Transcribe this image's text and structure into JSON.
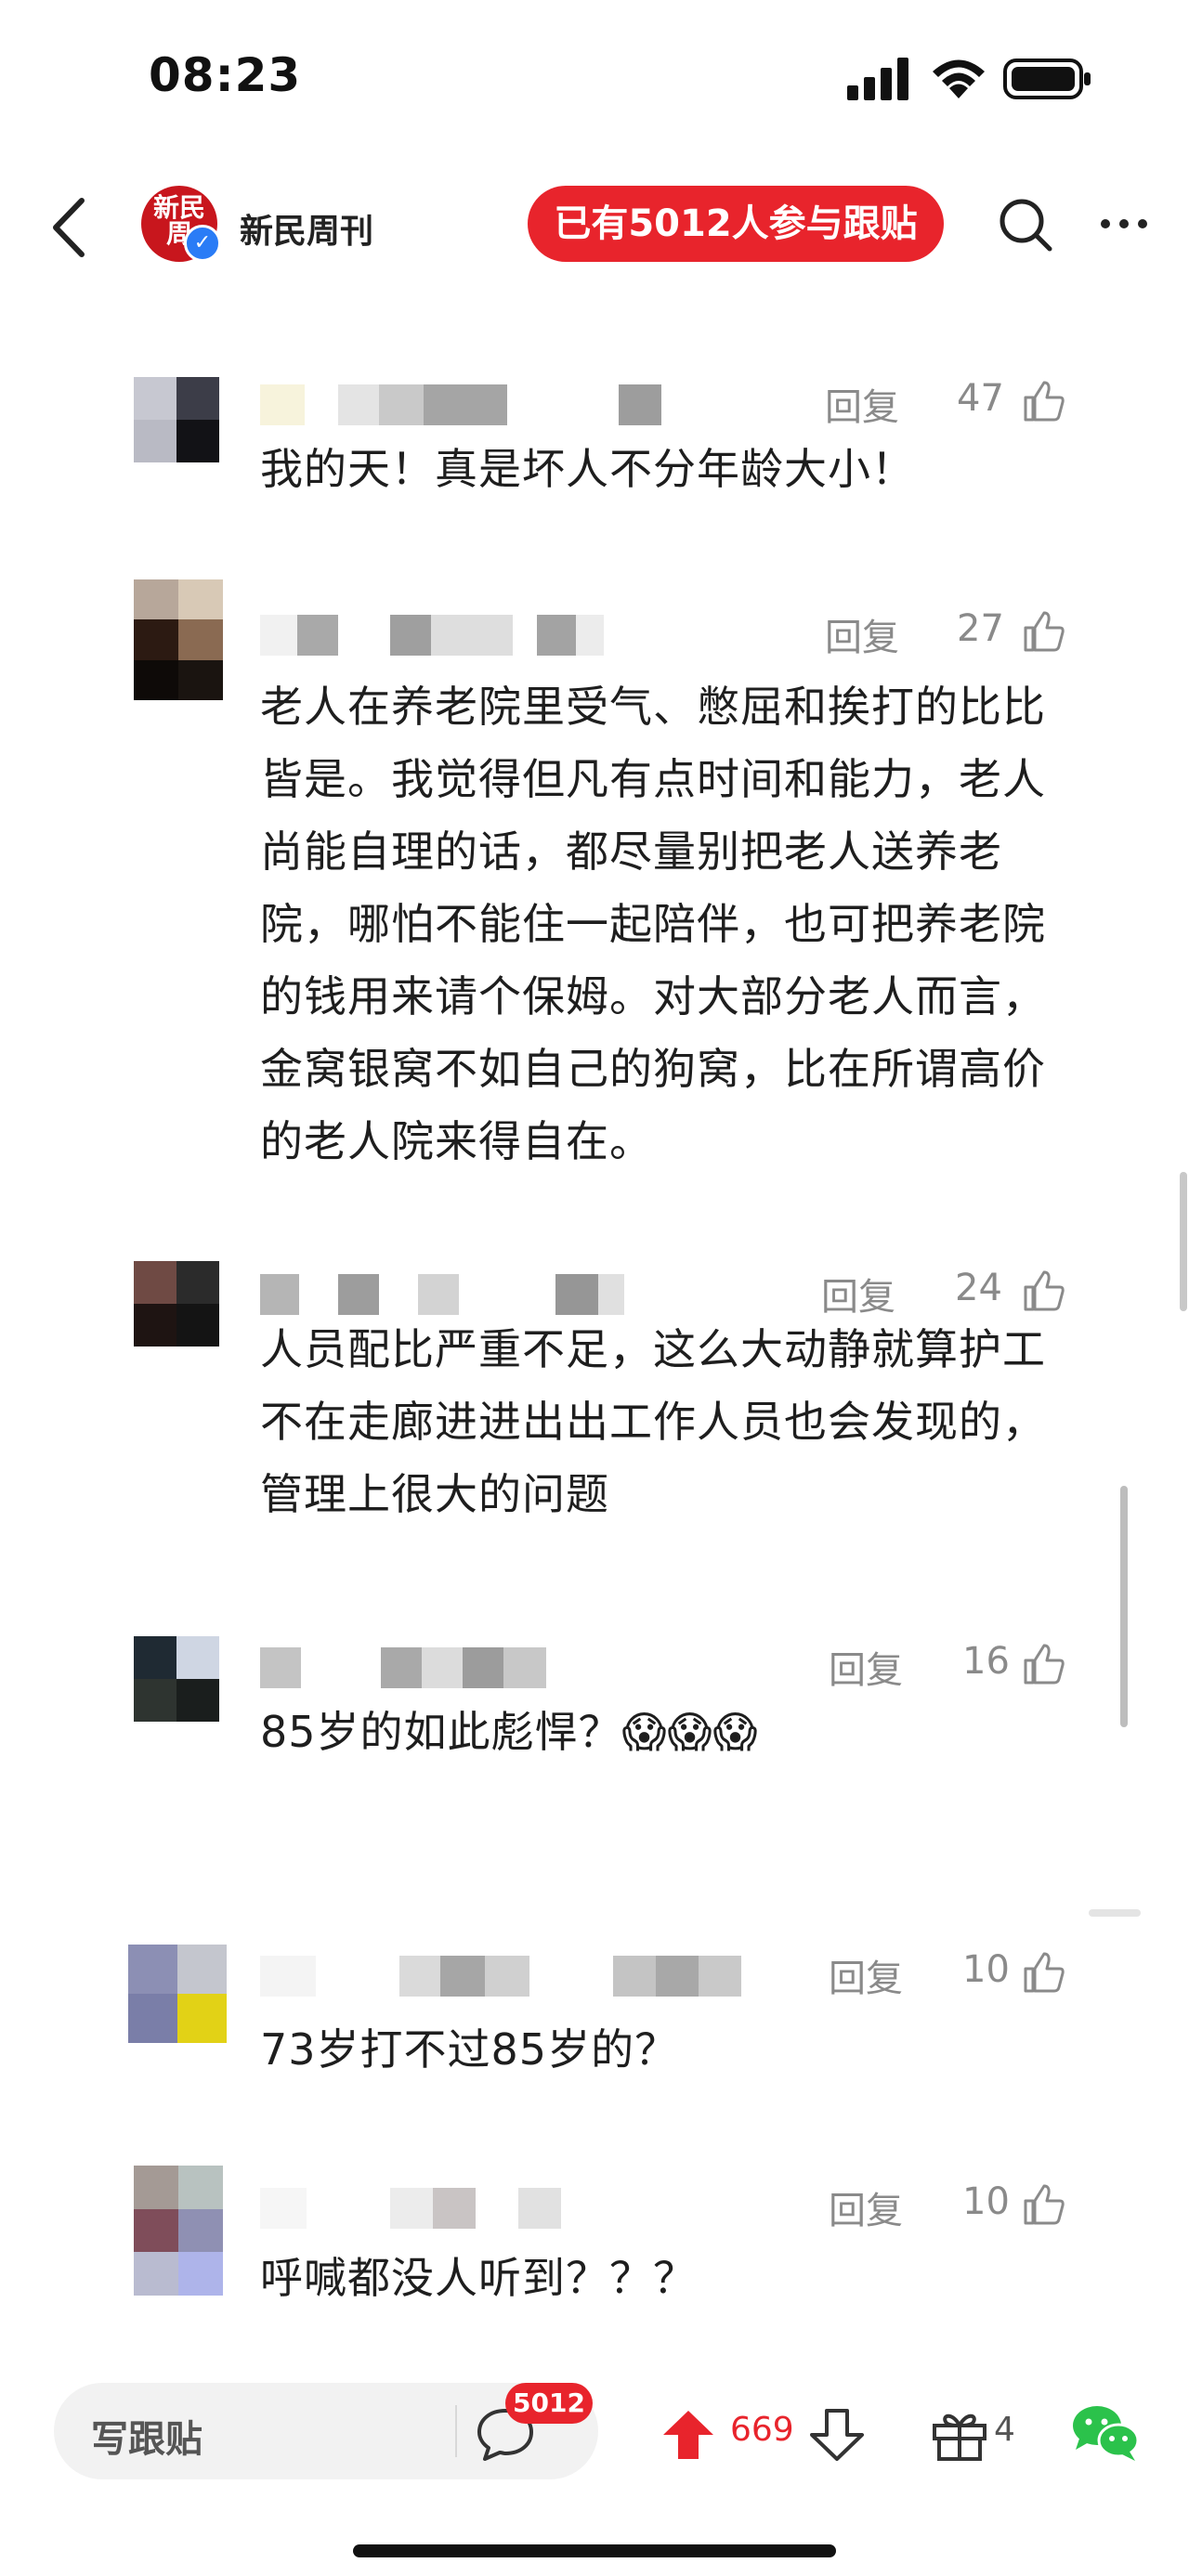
{
  "status_bar": {
    "time": "08:23"
  },
  "header": {
    "logo_text": "新民周",
    "account_name": "新民周刊",
    "participation": "已有5012人参与跟贴"
  },
  "comments": [
    {
      "reply_label": "回复",
      "likes": "47",
      "text": "我的天！真是坏人不分年龄大小！"
    },
    {
      "reply_label": "回复",
      "likes": "27",
      "text": "老人在养老院里受气、憋屈和挨打的比比皆是。我觉得但凡有点时间和能力，老人尚能自理的话，都尽量别把老人送养老院，哪怕不能住一起陪伴，也可把养老院的钱用来请个保姆。对大部分老人而言，金窝银窝不如自己的狗窝，比在所谓高价的老人院来得自在。"
    },
    {
      "reply_label": "回复",
      "likes": "24",
      "text": "人员配比严重不足，这么大动静就算护工不在走廊进进出出工作人员也会发现的，管理上很大的问题"
    },
    {
      "reply_label": "回复",
      "likes": "16",
      "text": "85岁的如此彪悍？😱😱😱"
    },
    {
      "reply_label": "回复",
      "likes": "10",
      "text": "73岁打不过85岁的？"
    },
    {
      "reply_label": "回复",
      "likes": "10",
      "text": "呼喊都没人听到？？？"
    }
  ],
  "bottom_bar": {
    "write_placeholder": "写跟贴",
    "comment_count": "5012",
    "upvotes": "669",
    "gifts": "4"
  },
  "colors": {
    "accent_red": "#e8242c",
    "verified_blue": "#2a7cf6",
    "muted_text": "#8a8a8a",
    "wechat_green": "#2bc24b"
  },
  "icons": [
    "back-icon",
    "verified-icon",
    "search-icon",
    "more-icon",
    "like-icon",
    "comment-icon",
    "upvote-icon",
    "downvote-icon",
    "gift-icon",
    "wechat-icon"
  ]
}
